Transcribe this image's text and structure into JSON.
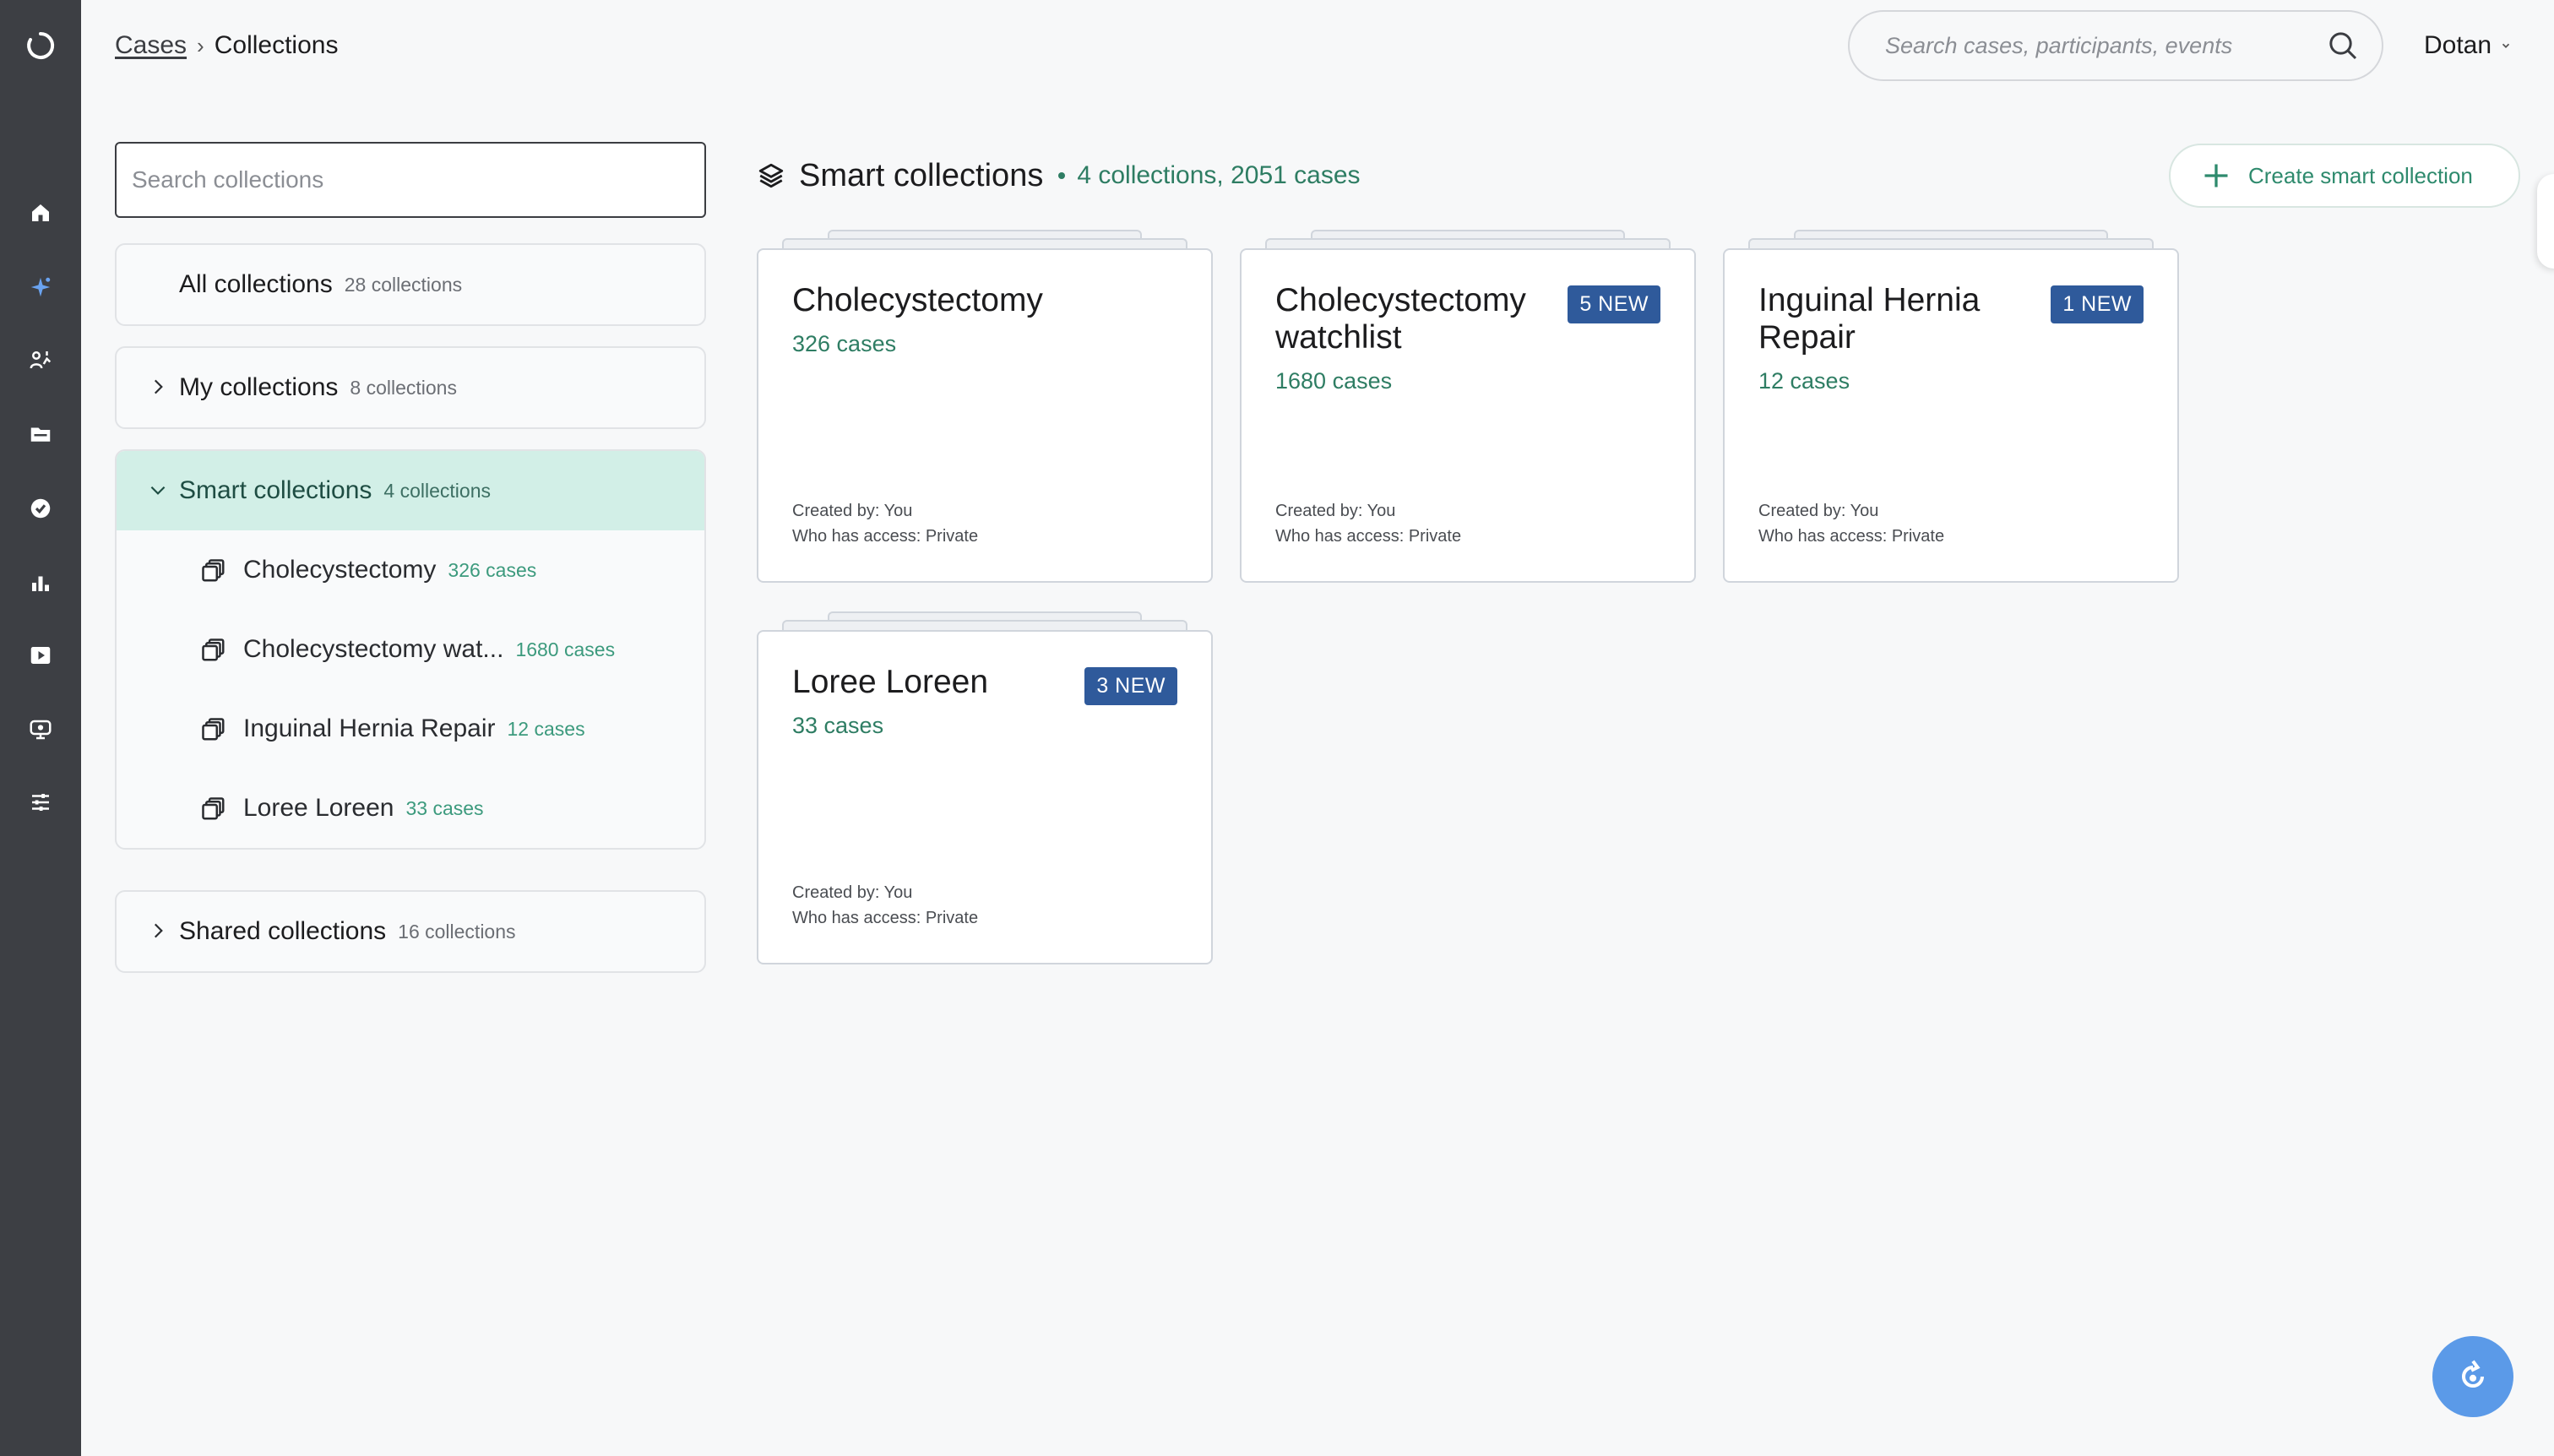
{
  "breadcrumb": {
    "parent": "Cases",
    "separator": "›",
    "current": "Collections"
  },
  "header": {
    "search_placeholder": "Search cases, participants, events",
    "user_name": "Dotan"
  },
  "sidebar_nav": [
    "home-icon",
    "sparkle-icon",
    "analytics-icon",
    "folder-icon",
    "verified-badge-icon",
    "bar-chart-icon",
    "play-video-icon",
    "monitor-icon",
    "sliders-icon"
  ],
  "collections_panel": {
    "search_placeholder": "Search collections",
    "all": {
      "label": "All collections",
      "count": "28 collections"
    },
    "mine": {
      "label": "My collections",
      "count": "8 collections"
    },
    "smart": {
      "label": "Smart collections",
      "count": "4 collections",
      "items": [
        {
          "name": "Cholecystectomy",
          "count": "326 cases"
        },
        {
          "name": "Cholecystectomy wat...",
          "count": "1680 cases"
        },
        {
          "name": "Inguinal Hernia Repair",
          "count": "12 cases"
        },
        {
          "name": "Loree Loreen",
          "count": "33 cases"
        }
      ]
    },
    "shared": {
      "label": "Shared collections",
      "count": "16 collections"
    }
  },
  "main": {
    "title": "Smart collections",
    "summary": "4 collections, 2051 cases",
    "create_label": "Create smart collection",
    "cards": [
      {
        "title": "Cholecystectomy",
        "count": "326 cases",
        "badge": "",
        "created_by": "Created by: You",
        "access": "Who has access: Private"
      },
      {
        "title": "Cholecystectomy watchlist",
        "count": "1680 cases",
        "badge": "5 NEW",
        "created_by": "Created by: You",
        "access": "Who has access: Private"
      },
      {
        "title": "Inguinal Hernia Repair",
        "count": "12 cases",
        "badge": "1 NEW",
        "created_by": "Created by: You",
        "access": "Who has access: Private"
      },
      {
        "title": "Loree Loreen",
        "count": "33 cases",
        "badge": "3 NEW",
        "created_by": "Created by: You",
        "access": "Who has access: Private"
      }
    ]
  },
  "colors": {
    "rail": "#3d3f44",
    "accent_green": "#2e7d63",
    "badge_blue": "#2f5a9b",
    "active_bg": "#d2efe7",
    "fab": "#5b9ae8"
  }
}
